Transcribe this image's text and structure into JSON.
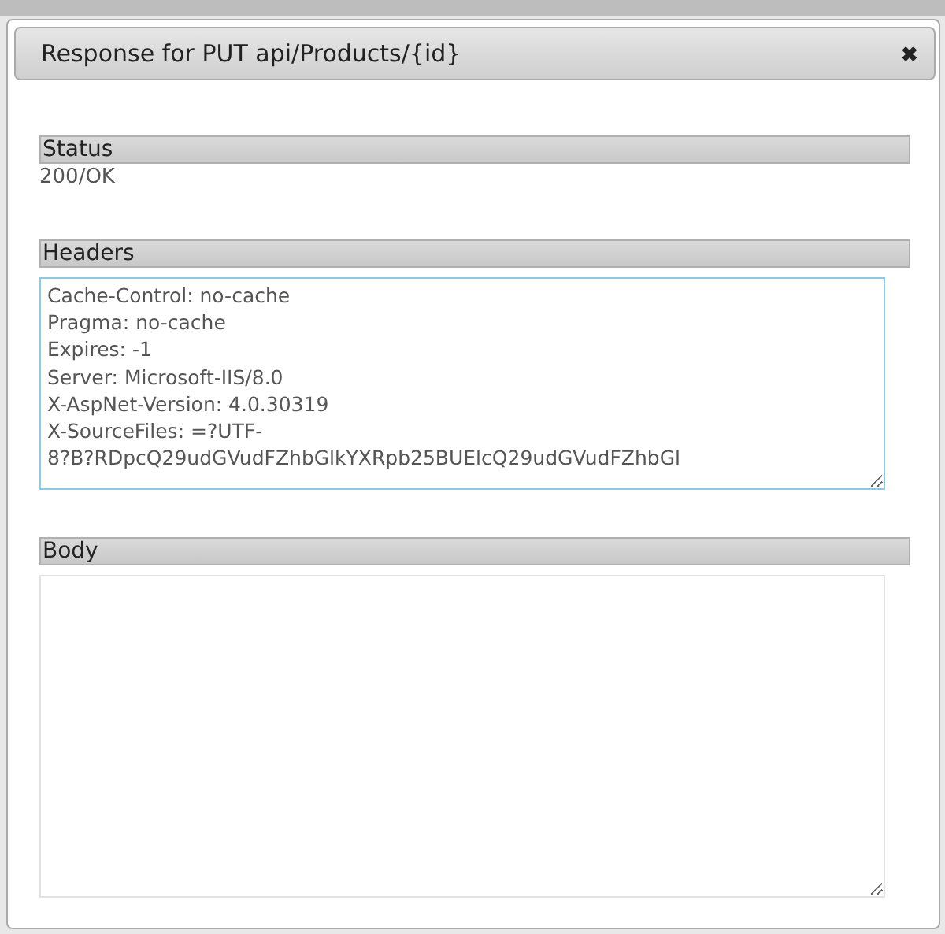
{
  "dialog": {
    "title": "Response for PUT api/Products/{id}",
    "close": "✖"
  },
  "sections": [
    {
      "kind": "text",
      "heading": "Status",
      "value": "200/OK"
    },
    {
      "kind": "box",
      "heading": "Headers",
      "lines": [
        "Cache-Control: no-cache",
        "Pragma: no-cache",
        "Expires: -1",
        "Server: Microsoft-IIS/8.0",
        "X-AspNet-Version: 4.0.30319",
        "X-SourceFiles: =?UTF-",
        "8?B?RDpcQ29udGVudFZhbGlkYXRpb25BUElcQ29udGVudFZhbGl"
      ],
      "focused": true
    },
    {
      "kind": "box",
      "heading": "Body",
      "focused": false
    }
  ]
}
